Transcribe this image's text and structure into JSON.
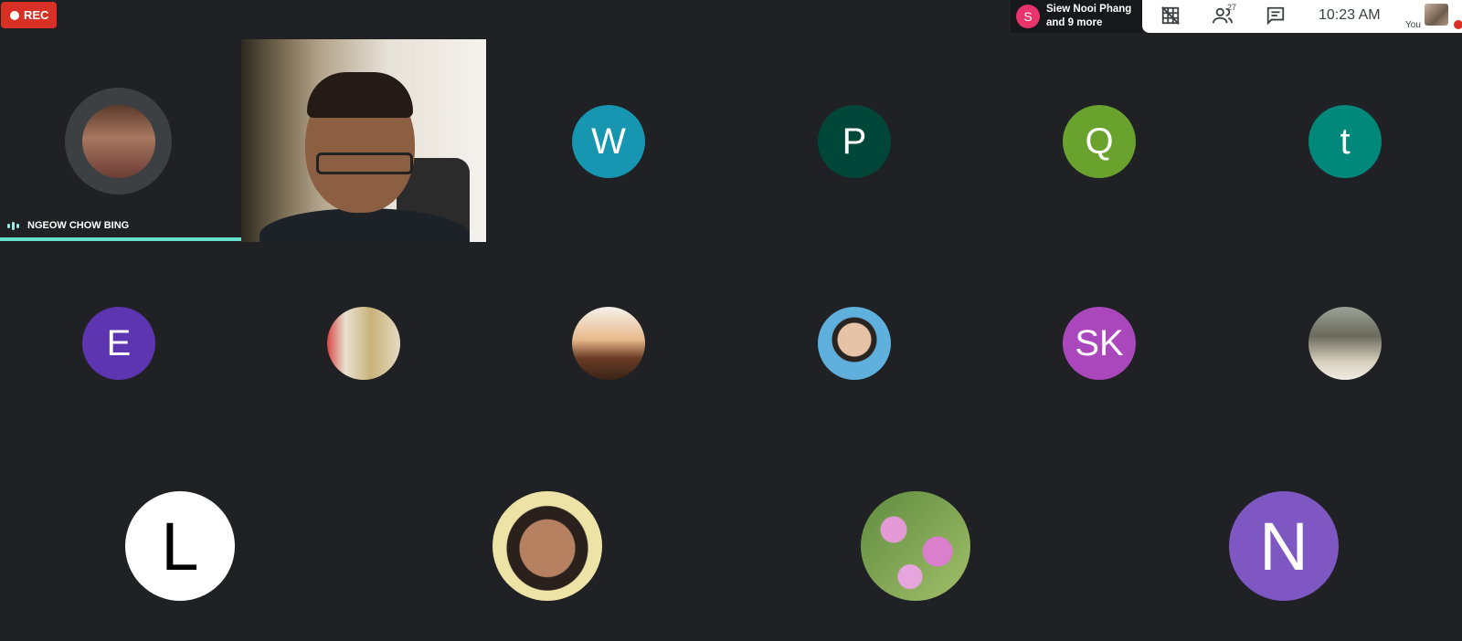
{
  "recording": {
    "label": "REC"
  },
  "presenting": {
    "initial": "S",
    "line1": "Siew Nooi Phang",
    "line2": "and 9 more"
  },
  "controls": {
    "participants_count": "27",
    "time": "10:23  AM",
    "you_label": "You",
    "icons": [
      "no-grid-icon",
      "people-icon",
      "chat-icon"
    ]
  },
  "speaker": {
    "name": "NGEOW CHOW BING"
  },
  "participants_row1": [
    {
      "initial": "W",
      "color": "#1696b0"
    },
    {
      "initial": "P",
      "color": "#00473a"
    },
    {
      "initial": "Q",
      "color": "#6aa22e"
    },
    {
      "initial": "t",
      "color": "#00897b"
    }
  ],
  "participants_row2": [
    {
      "initial": "E",
      "color": "#5e35b1"
    },
    {
      "initial": "",
      "color": "#cfc8b5"
    },
    {
      "initial": "",
      "color": "#d9a77c"
    },
    {
      "initial": "",
      "color": "#79b6d8"
    },
    {
      "initial": "SK",
      "color": "#ab47bc"
    },
    {
      "initial": "",
      "color": "#8a8578"
    }
  ],
  "participants_row3": [
    {
      "initial": "L",
      "color": "#ffffff",
      "text_color": "#000000"
    },
    {
      "initial": "",
      "color": "#e8dd9a"
    },
    {
      "initial": "",
      "color": "#79a35a"
    },
    {
      "initial": "N",
      "color": "#7e57c2"
    }
  ]
}
